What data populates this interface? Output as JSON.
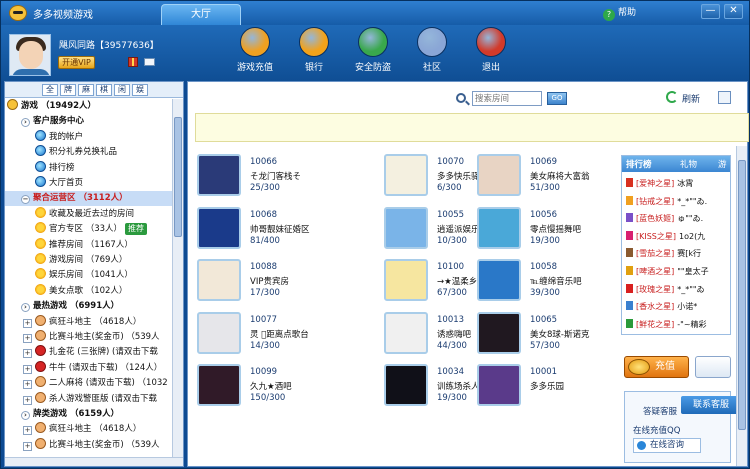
{
  "app": {
    "title": "多多视频游戏",
    "tab": "大厅",
    "help": "帮助",
    "min": "—",
    "close": "✕"
  },
  "user": {
    "name": "飓风同路【39577636】",
    "vip": "开通VIP"
  },
  "toolbar": [
    {
      "label": "游戏充值",
      "icon": "duo-coin-icon",
      "color": "#f0a020"
    },
    {
      "label": "银行",
      "icon": "bank-icon",
      "color": "#f2a21a"
    },
    {
      "label": "安全防盗",
      "icon": "lock-icon",
      "color": "#39a84c"
    },
    {
      "label": "社区",
      "icon": "chat-bubble-icon",
      "color": "#8aa6d6"
    },
    {
      "label": "退出",
      "icon": "exit-door-icon",
      "color": "#d23a2a"
    }
  ],
  "categories": [
    "全",
    "牌",
    "麻",
    "棋",
    "闲",
    "娱"
  ],
  "tree": [
    {
      "text": "游戏 （19492人）",
      "level": 0,
      "icon": "smile",
      "bold": true
    },
    {
      "text": "客户服务中心",
      "level": 1,
      "icon": "expand",
      "bold": true
    },
    {
      "text": "我的帐户",
      "level": 2,
      "icon": "ie"
    },
    {
      "text": "积分礼券兑换礼品",
      "level": 2,
      "icon": "ie"
    },
    {
      "text": "排行榜",
      "level": 2,
      "icon": "ie"
    },
    {
      "text": "大厅首页",
      "level": 2,
      "icon": "ie"
    },
    {
      "text": "聚合运营区 （3112人）",
      "level": 1,
      "icon": "expand",
      "bold": true,
      "selected": true,
      "red": true
    },
    {
      "text": "收藏及最近去过的房间",
      "level": 2,
      "icon": "sun"
    },
    {
      "text": "官方专区 （33人）",
      "level": 2,
      "icon": "sun",
      "tag": "推荐"
    },
    {
      "text": "推荐房间 （1167人）",
      "level": 2,
      "icon": "sun"
    },
    {
      "text": "游戏房间 （769人）",
      "level": 2,
      "icon": "sun"
    },
    {
      "text": "娱乐房间 （1041人）",
      "level": 2,
      "icon": "sun"
    },
    {
      "text": "美女点歌 （102人）",
      "level": 2,
      "icon": "sun"
    },
    {
      "text": "最热游戏 （6991人）",
      "level": 1,
      "icon": "expand",
      "bold": true
    },
    {
      "text": "疯狂斗地主 （4618人）",
      "level": 2,
      "icon": "face",
      "expand": true
    },
    {
      "text": "比赛斗地主(奖金币) （539人",
      "level": 2,
      "icon": "face",
      "expand": true
    },
    {
      "text": "扎金花 (三张牌) (请双击下载",
      "level": 2,
      "icon": "red",
      "expand": true
    },
    {
      "text": "牛牛 (请双击下载) （124人）",
      "level": 2,
      "icon": "red",
      "expand": true
    },
    {
      "text": "二人麻将 (请双击下载) （1032",
      "level": 2,
      "icon": "face",
      "expand": true
    },
    {
      "text": "杀人游戏警匪版 (请双击下载",
      "level": 2,
      "icon": "face",
      "expand": true
    },
    {
      "text": "牌类游戏 （6159人）",
      "level": 1,
      "icon": "expand",
      "bold": true
    },
    {
      "text": "疯狂斗地主 （4618人）",
      "level": 2,
      "icon": "face",
      "expand": true
    },
    {
      "text": "比赛斗地主(奖金币) （539人",
      "level": 2,
      "icon": "face",
      "expand": true
    }
  ],
  "search": {
    "placeholder": "搜索房间",
    "go": "GO",
    "refresh": "刷新"
  },
  "rooms": [
    {
      "id": "10066",
      "name": "そ龙门客栈そ",
      "count": "25/300",
      "thumb": "#2a3a78"
    },
    {
      "id": "10070",
      "name": "多多快乐驿站",
      "count": "6/300",
      "thumb": "#f4f0e0"
    },
    {
      "id": "10069",
      "name": "美女麻将大富翁",
      "count": "51/300",
      "thumb": "#e8d4c4"
    },
    {
      "id": "10068",
      "name": "帅哥靓妹征婚区",
      "count": "81/400",
      "thumb": "#1a3a8a"
    },
    {
      "id": "10055",
      "name": "逍遥派娱乐部",
      "count": "10/300",
      "thumb": "#7ab4e8"
    },
    {
      "id": "10056",
      "name": "零点慢摇舞吧",
      "count": "19/300",
      "thumb": "#4aa8d8"
    },
    {
      "id": "10088",
      "name": "VIP贵宾房",
      "count": "17/300",
      "thumb": "#f2e8d8"
    },
    {
      "id": "10100",
      "name": "→★温柔乡★←",
      "count": "67/300",
      "thumb": "#f6e6a0"
    },
    {
      "id": "10058",
      "name": "℡缠绵音乐吧",
      "count": "39/300",
      "thumb": "#2a78c8"
    },
    {
      "id": "10077",
      "name": "灵 ゚距离点歌台",
      "count": "14/300",
      "thumb": "#e6e6ea"
    },
    {
      "id": "10013",
      "name": "诱惑嗨吧",
      "count": "44/300",
      "thumb": "#f0f0f0"
    },
    {
      "id": "10065",
      "name": "美女8球-斯诺克",
      "count": "57/300",
      "thumb": "#201820"
    },
    {
      "id": "10099",
      "name": "久九★酒吧",
      "count": "150/300",
      "thumb": "#301a28"
    },
    {
      "id": "10034",
      "name": "训练场杀人游戏",
      "count": "19/300",
      "thumb": "#101018"
    },
    {
      "id": "10001",
      "name": "多多乐园",
      "count": "",
      "thumb": "#5a3a8a"
    }
  ],
  "rank": {
    "tabs": [
      "排行榜",
      "礼物",
      "游"
    ],
    "items": [
      {
        "tag": "[爱神之星]",
        "name": "冰霄"
      },
      {
        "tag": "[钻戒之星]",
        "name": "*_*\"\"ゐ."
      },
      {
        "tag": "[蓝色妖姬]",
        "name": "ゅ\"\"ゐ."
      },
      {
        "tag": "[KISS之星]",
        "name": "1o2(九"
      },
      {
        "tag": "[雪茄之星]",
        "name": "赛[k行"
      },
      {
        "tag": "[啤酒之星]",
        "name": "\"\"皇太子"
      },
      {
        "tag": "[玫瑰之星]",
        "name": "*_*\"\"ゐ"
      },
      {
        "tag": "[香水之星]",
        "name": "小诺*"
      },
      {
        "tag": "[鲜花之星]",
        "name": "-\"~精彩"
      }
    ],
    "medals": [
      "#d83020",
      "#f0a020",
      "#7a50c8",
      "#d82070",
      "#8a5a30",
      "#e0a010",
      "#d82020",
      "#3a80d0",
      "#2a9a3a"
    ]
  },
  "service": {
    "recharge": "充值",
    "label": "答疑客服",
    "cs_button": "联系客服",
    "qq": "在线充值QQ",
    "consult": "在线咨询"
  }
}
